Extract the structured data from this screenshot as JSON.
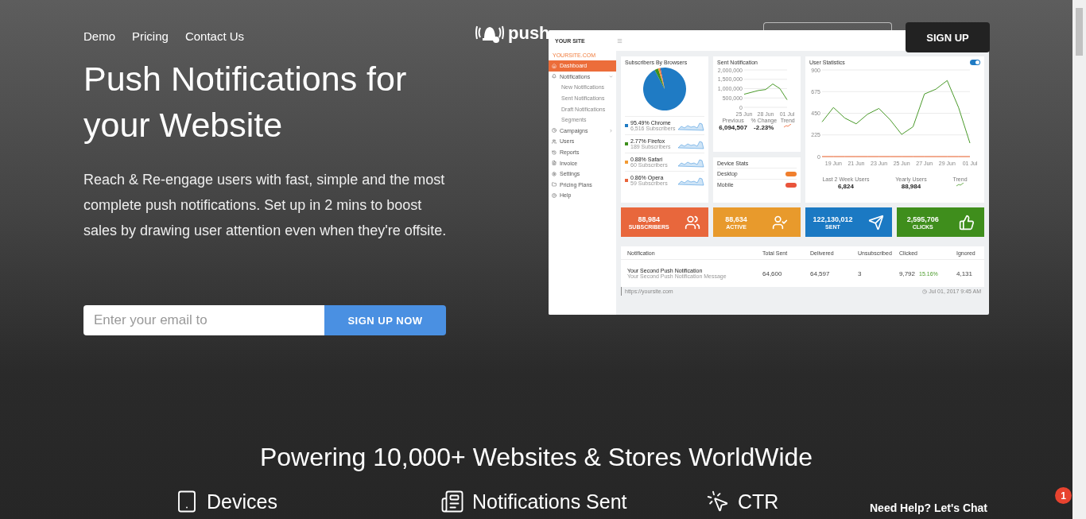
{
  "nav": {
    "links": [
      "Demo",
      "Pricing",
      "Contact Us"
    ]
  },
  "logo": {
    "text": "push"
  },
  "header_buttons": {
    "sign_up": "SIGN UP"
  },
  "hero": {
    "title": "Push Notifications for your Website",
    "text": "Reach & Re-engage users with fast, simple and the most complete push notifications. Set up in 2 mins to boost sales by drawing user attention even when they're offsite.",
    "email": {
      "placeholder": "Enter your email to"
    },
    "button": "SIGN UP NOW"
  },
  "dashboard": {
    "site": "YOUR SITE",
    "domain": "YOURSITE.COM",
    "sidebar": [
      {
        "label": "Dashboard",
        "selected": true
      },
      {
        "label": "Notifications",
        "selected": false,
        "expanded": true,
        "children": [
          {
            "label": "New Notifications"
          },
          {
            "label": "Sent Notifications"
          },
          {
            "label": "Draft Notifications"
          },
          {
            "label": "Segments"
          }
        ]
      },
      {
        "label": "Campaigns",
        "selected": false,
        "expanded": false
      },
      {
        "label": "Users",
        "selected": false
      },
      {
        "label": "Reports",
        "selected": false
      },
      {
        "label": "Invoice",
        "selected": false
      },
      {
        "label": "Settings",
        "selected": false
      },
      {
        "label": "Pricing Plans",
        "selected": false
      },
      {
        "label": "Help",
        "selected": false
      }
    ],
    "browsers": {
      "title": "Subscribers By Browsers",
      "chart_data": {
        "type": "pie",
        "categories": [
          "Chrome",
          "Firefox",
          "Safari",
          "Opera"
        ],
        "values": [
          95.49,
          2.77,
          0.88,
          0.86
        ]
      },
      "items": [
        {
          "share": "95.49%",
          "sub": "6,516 Subscribers",
          "color": "#1f7bc4"
        },
        {
          "share": "2.77%",
          "sub": "189 Subscribers",
          "color": "#3d8f1c"
        },
        {
          "share": "0.88%",
          "sub": "60 Subscribers",
          "color": "#f29a33"
        },
        {
          "share": "0.86%",
          "sub": "59 Subscribers",
          "color": "#e9643b"
        }
      ]
    },
    "sent": {
      "title": "Sent Notification",
      "chart_data": {
        "type": "line",
        "categories": [
          "25 Jun",
          null,
          null,
          "28 Jun",
          null,
          null,
          "01 Jul"
        ],
        "series": [
          {
            "color": "#4a9a2a",
            "values": [
              700000,
              800000,
              900000,
              950000,
              1250000,
              1000000,
              400000
            ]
          }
        ],
        "ylim": [
          0,
          2000000
        ],
        "grid": true,
        "yticks": [
          {
            "value": 0,
            "label": "0"
          },
          {
            "value": 500000,
            "label": "500,000"
          },
          {
            "value": 1000000,
            "label": "1,000,000"
          },
          {
            "value": 1500000,
            "label": "1,500,000"
          },
          {
            "value": 2000000,
            "label": "2,000,000"
          }
        ]
      },
      "stats": [
        {
          "label": "Previous",
          "value": "6,094,507"
        },
        {
          "label": "% Change",
          "value": "-2.23%"
        },
        {
          "label": "Trend"
        }
      ]
    },
    "devices": {
      "title": "Device Stats",
      "items": [
        {
          "label": "Desktop",
          "color": "#f07f2d"
        },
        {
          "label": "Mobile",
          "color": "#e9543b"
        }
      ]
    },
    "users": {
      "title": "User Statistics",
      "toggle": {
        "on": true
      },
      "chart_data": {
        "type": "line",
        "categories": [
          null,
          "19 Jun",
          null,
          "21 Jun",
          null,
          "23 Jun",
          null,
          "25 Jun",
          null,
          "27 Jun",
          null,
          "29 Jun",
          null,
          "01 Jul"
        ],
        "series": [
          {
            "color": "#4a9a2a",
            "values": [
              360,
              510,
              400,
              340,
              440,
              500,
              380,
              230,
              310,
              650,
              700,
              790,
              510,
              140
            ]
          },
          {
            "color": "#f0622d",
            "values": [
              0,
              0,
              0,
              0,
              0,
              0,
              0,
              0,
              0,
              0,
              0,
              0,
              0,
              0
            ]
          }
        ],
        "ylim": [
          0,
          900
        ],
        "grid": true,
        "yticks": [
          0,
          225,
          450,
          675,
          900
        ]
      },
      "stats": [
        {
          "label": "Last 2 Week Users",
          "value": "6,824"
        },
        {
          "label": "Yearly Users",
          "value": "88,984"
        },
        {
          "label": "Trend"
        }
      ]
    },
    "tiles": [
      {
        "kind": "subscribers",
        "value": "88,984",
        "label": "SUBSCRIBERS",
        "color": "#e8673c"
      },
      {
        "kind": "active",
        "value": "88,634",
        "label": "ACTIVE",
        "color": "#e89a2c"
      },
      {
        "kind": "sent",
        "value": "122,130,012",
        "label": "SENT",
        "color": "#1b79c3"
      },
      {
        "kind": "clicks",
        "value": "2,595,706",
        "label": "CLICKS",
        "color": "#3f8e1c"
      }
    ],
    "table": {
      "columns": [
        "Notification",
        "Total Sent",
        "Delivered",
        "Unsubscribed",
        "Clicked",
        "Ignored"
      ],
      "rows": [
        {
          "title": "Your Second Push Notification",
          "message": "Your Second Push Notification Message",
          "total_sent": "64,600",
          "delivered": "64,597",
          "unsubscribed": "3",
          "clicked": "9,792",
          "ctr": "15.16%",
          "ignored": "4,131"
        }
      ],
      "url": "https://yoursite.com",
      "date": "Jul 01, 2017 9:45 AM"
    }
  },
  "powering": {
    "title": "Powering 10,000+ Websites & Stores WorldWide",
    "stats": [
      {
        "kind": "devices",
        "label": "Devices"
      },
      {
        "kind": "notifications",
        "label": "Notifications Sent"
      },
      {
        "kind": "ctr",
        "label": "CTR"
      }
    ]
  },
  "chat": {
    "label": "Need Help? Let's Chat",
    "badge": "1"
  }
}
